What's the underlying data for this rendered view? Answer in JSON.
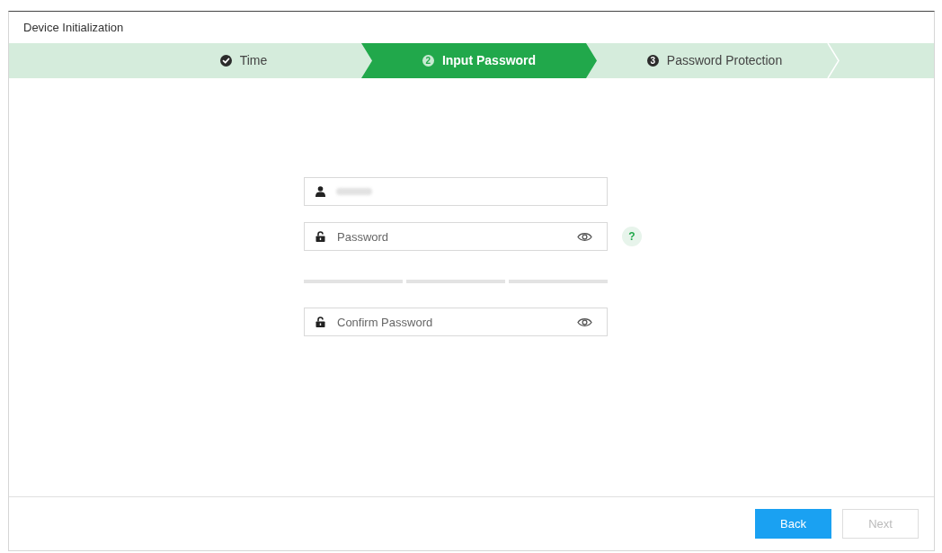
{
  "window": {
    "title": "Device Initialization"
  },
  "steps": [
    {
      "label": "Time",
      "done": true,
      "selected": false
    },
    {
      "number": "2",
      "label": "Input Password",
      "done": false,
      "selected": true
    },
    {
      "number": "3",
      "label": "Password Protection",
      "done": false,
      "selected": false
    }
  ],
  "fields": [
    {
      "kind": "username",
      "value_blurred": true
    },
    {
      "kind": "password",
      "placeholder": "Password",
      "help": "?"
    },
    {
      "kind": "strength_meter",
      "segments": [
        {
          "on": false
        },
        {
          "on": false
        },
        {
          "on": false
        }
      ]
    },
    {
      "kind": "password",
      "placeholder": "Confirm Password"
    }
  ],
  "buttons": [
    {
      "label": "Back",
      "disabled": false
    },
    {
      "label": "Next",
      "disabled": true
    }
  ]
}
